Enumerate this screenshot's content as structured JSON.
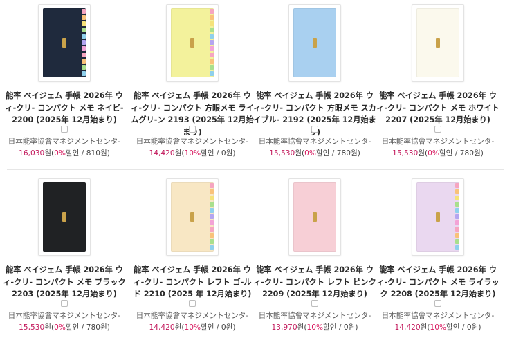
{
  "colors": {
    "price": "#c2185b",
    "discount": "#d81b60",
    "publisher": "#5d5d5d"
  },
  "products": [
    {
      "title": "能率 ベイジェム 手帳 2026年 ウィ-クリ- コンパクト メモ ネイビ- 2200 (2025年 12月始まり)",
      "publisher": "日本能率協會マネジメントセンタ-",
      "price": "16,030",
      "price_unit": "원(",
      "discount": "0%",
      "discount_tail": "할인 / 810원)",
      "cover_color": "#1f2a3d",
      "tabs": true,
      "checked": false
    },
    {
      "title": "能率 ベイジェム 手帳 2026年 ウィ-クリ- コンパクト 方眼メモ ライムグリ-ン 2193 (2025年 12月始まり)",
      "publisher": "日本能率協會マネジメントセンタ-",
      "price": "14,420",
      "price_unit": "원(",
      "discount": "10%",
      "discount_tail": "할인 / 0원)",
      "cover_color": "#f3f29c",
      "tabs": true,
      "checked": false
    },
    {
      "title": "能率 ベイジェム 手帳 2026年 ウィ-クリ- コンパクト 方眼メモ スカイブル- 2192 (2025年 12月始まり)",
      "publisher": "日本能率協會マネジメントセンタ-",
      "price": "15,530",
      "price_unit": "원(",
      "discount": "0%",
      "discount_tail": "할인 / 780원)",
      "cover_color": "#a9d0f0",
      "tabs": false,
      "checked": false
    },
    {
      "title": "能率 ベイジェム 手帳 2026年 ウィ-クリ- コンパクト メモ ホワイト 2207 (2025年 12月始まり)",
      "publisher": "日本能率協會マネジメントセンタ-",
      "price": "15,530",
      "price_unit": "원(",
      "discount": "0%",
      "discount_tail": "할인 / 780원)",
      "cover_color": "#fbf9ed",
      "tabs": false,
      "checked": false
    },
    {
      "title": "能率 ベイジェム 手帳 2026年 ウィ-クリ- コンパクト メモ ブラック 2203 (2025年 12月始まり)",
      "publisher": "日本能率協會マネジメントセンタ-",
      "price": "15,530",
      "price_unit": "원(",
      "discount": "0%",
      "discount_tail": "할인 / 780원)",
      "cover_color": "#202224",
      "tabs": false,
      "checked": false
    },
    {
      "title": "能率 ベイジェム 手帳 2026年 ウィ-クリ- コンパクト レフト ゴ-ルド 2210 (2025 年 12月始まり)",
      "publisher": "日本能率協會マネジメントセンタ-",
      "price": "14,420",
      "price_unit": "원(",
      "discount": "10%",
      "discount_tail": "할인 / 0원)",
      "cover_color": "#f8e7c4",
      "tabs": true,
      "checked": false
    },
    {
      "title": "能率 ベイジェム 手帳 2026年 ウィ-クリ- コンパクト レフト ピンク 2209 (2025年 12月始まり)",
      "publisher": "日本能率協會マネジメントセンタ-",
      "price": "13,970",
      "price_unit": "원(",
      "discount": "10%",
      "discount_tail": "할인 / 0원)",
      "cover_color": "#f7cfd6",
      "tabs": false,
      "checked": false
    },
    {
      "title": "能率 ベイジェム 手帳 2026年 ウィ-クリ- コンパクト メモ ライラック 2208 (2025年 12月始まり)",
      "publisher": "日本能率協會マネジメントセンタ-",
      "price": "14,420",
      "price_unit": "원(",
      "discount": "10%",
      "discount_tail": "할인 / 0원)",
      "cover_color": "#ead8f0",
      "tabs": true,
      "checked": false
    }
  ]
}
